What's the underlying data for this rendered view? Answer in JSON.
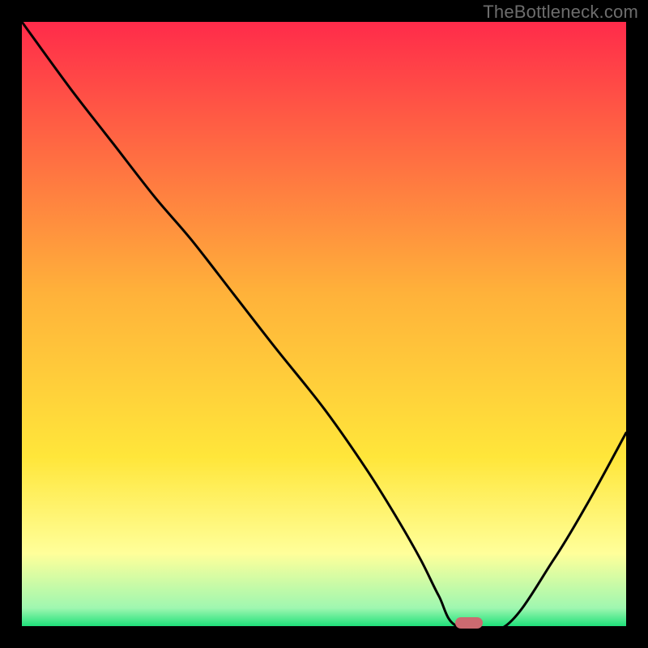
{
  "watermark": "TheBottleneck.com",
  "colors": {
    "red": "#ff2b4a",
    "orange": "#ff9a3a",
    "yellow": "#ffe63a",
    "paleyellow": "#ffff9a",
    "green": "#1fe07a",
    "marker": "#cc6a70",
    "line": "#000000",
    "frame": "#000000"
  },
  "chart_data": {
    "type": "line",
    "title": "",
    "xlabel": "",
    "ylabel": "",
    "xlim": [
      0,
      100
    ],
    "ylim": [
      0,
      100
    ],
    "grid": false,
    "legend": false,
    "series": [
      {
        "name": "bottleneck-curve",
        "x": [
          0,
          8,
          15,
          22,
          28,
          35,
          42,
          50,
          57,
          62,
          66,
          69,
          72,
          80,
          88,
          94,
          100
        ],
        "y": [
          100,
          89,
          80,
          71,
          64,
          55,
          46,
          36,
          26,
          18,
          11,
          5,
          0,
          0,
          11,
          21,
          32
        ]
      }
    ],
    "annotations": [
      {
        "name": "optimal-marker",
        "x": 74,
        "y": 0
      }
    ],
    "background_gradient_stops": [
      {
        "pct": 0,
        "color": "#ff2b4a"
      },
      {
        "pct": 45,
        "color": "#ffb23a"
      },
      {
        "pct": 72,
        "color": "#ffe63a"
      },
      {
        "pct": 88,
        "color": "#ffff9a"
      },
      {
        "pct": 97,
        "color": "#9ff7b0"
      },
      {
        "pct": 100,
        "color": "#1fe07a"
      }
    ]
  }
}
